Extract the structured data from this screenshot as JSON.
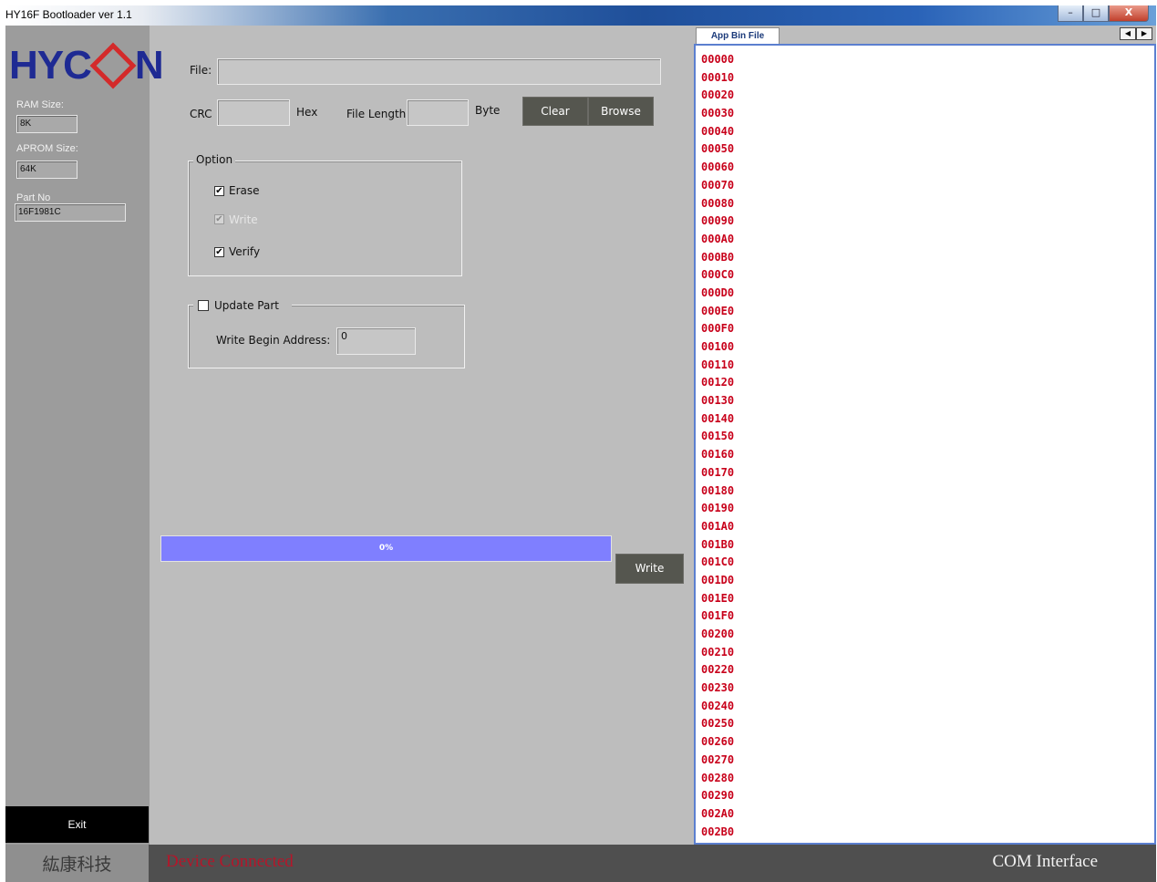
{
  "window": {
    "title": "HY16F Bootloader ver 1.1",
    "controls": {
      "minimize": "–",
      "maximize": "□",
      "close": "X"
    }
  },
  "sidebar": {
    "logo_prefix": "HYC",
    "logo_suffix": "N",
    "ram_label": "RAM Size:",
    "ram_value": "8K",
    "aprom_label": "APROM Size:",
    "aprom_value": "64K",
    "part_label": "Part No",
    "part_value": "16F1981C",
    "exit_label": "Exit"
  },
  "main": {
    "file_label": "File:",
    "file_value": "",
    "crc_label": "CRC",
    "crc_value": "",
    "hex_label": "Hex",
    "file_length_label": "File Length:",
    "file_length_value": "",
    "byte_label": "Byte",
    "clear_label": "Clear",
    "browse_label": "Browse",
    "option_group": {
      "legend": "Option",
      "erase_label": "Erase",
      "erase_checked": true,
      "write_label": "Write",
      "write_checked": true,
      "write_enabled": false,
      "verify_label": "Verify",
      "verify_checked": true
    },
    "update_part": {
      "label": "Update Part",
      "checked": false,
      "write_begin_label": "Write Begin Address:",
      "write_begin_value": "0"
    },
    "progress": {
      "value": 0,
      "text": "0%"
    },
    "write_button_label": "Write"
  },
  "hex_panel": {
    "tab_label": "App Bin File",
    "addresses": [
      "00000",
      "00010",
      "00020",
      "00030",
      "00040",
      "00050",
      "00060",
      "00070",
      "00080",
      "00090",
      "000A0",
      "000B0",
      "000C0",
      "000D0",
      "000E0",
      "000F0",
      "00100",
      "00110",
      "00120",
      "00130",
      "00140",
      "00150",
      "00160",
      "00170",
      "00180",
      "00190",
      "001A0",
      "001B0",
      "001C0",
      "001D0",
      "001E0",
      "001F0",
      "00200",
      "00210",
      "00220",
      "00230",
      "00240",
      "00250",
      "00260",
      "00270",
      "00280",
      "00290",
      "002A0",
      "002B0"
    ]
  },
  "status_bar": {
    "company": "紘康科技",
    "connection": "Device Connected",
    "interface": "COM Interface"
  }
}
